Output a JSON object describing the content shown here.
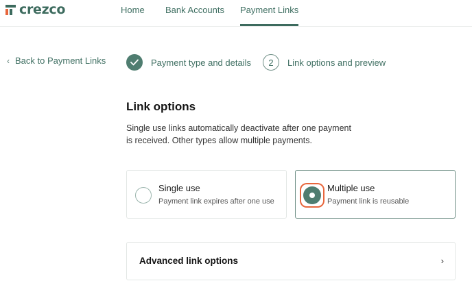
{
  "brand": {
    "name": "crezco",
    "colors": {
      "primary": "#3d6b5e",
      "accent": "#e8663c"
    }
  },
  "nav": {
    "items": [
      {
        "label": "Home",
        "active": false
      },
      {
        "label": "Bank Accounts",
        "active": false
      },
      {
        "label": "Payment Links",
        "active": true
      }
    ]
  },
  "back_link": {
    "label": "Back to Payment Links",
    "icon": "chevron-left-icon"
  },
  "stepper": {
    "steps": [
      {
        "label": "Payment type and details",
        "status": "done",
        "icon": "check-icon"
      },
      {
        "number": "2",
        "label": "Link options and preview",
        "status": "current"
      }
    ]
  },
  "link_options": {
    "title": "Link options",
    "description": "Single use links automatically deactivate after one payment is received. Other types allow multiple payments.",
    "options": [
      {
        "title": "Single use",
        "subtitle": "Payment link expires after one use",
        "selected": false
      },
      {
        "title": "Multiple use",
        "subtitle": "Payment link is reusable",
        "selected": true
      }
    ]
  },
  "advanced": {
    "title": "Advanced link options",
    "icon": "chevron-right-icon"
  }
}
